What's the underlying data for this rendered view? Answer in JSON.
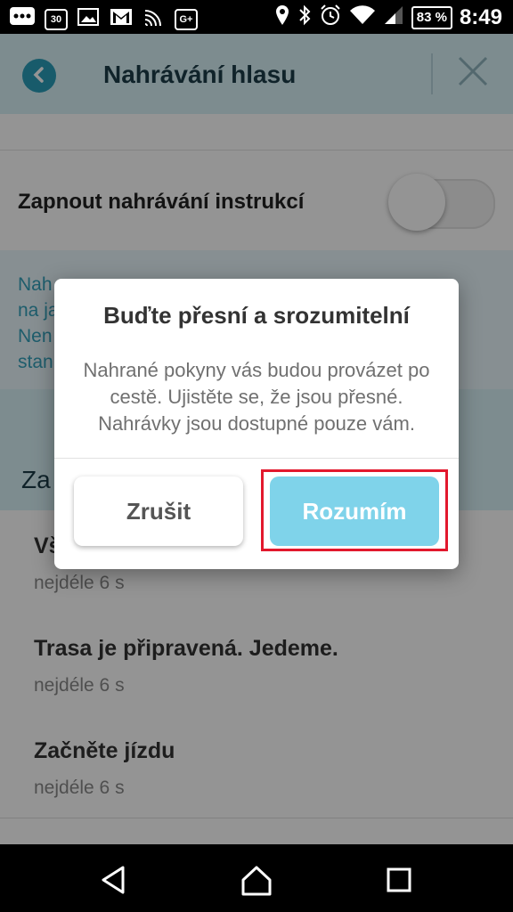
{
  "status_bar": {
    "left_icons": [
      "more-dots-icon",
      "calendar-icon",
      "image-icon",
      "gmail-icon",
      "cast-icon",
      "google-plus-icon"
    ],
    "calendar_day": "30",
    "gplus_text": "G+",
    "battery": "83 %",
    "time": "8:49"
  },
  "header": {
    "title": "Nahrávání hlasu"
  },
  "toggle": {
    "label": "Zapnout nahrávání instrukcí",
    "enabled": false
  },
  "info": {
    "visible_fragments": [
      "Nah",
      "na ja",
      "Nen",
      "stan"
    ]
  },
  "section": {
    "title_fragment": "Za"
  },
  "list": [
    {
      "title": "Vš",
      "subtitle": "nejdéle 6 s"
    },
    {
      "title": "Trasa je připravená. Jedeme.",
      "subtitle": "nejdéle 6 s"
    },
    {
      "title": "Začněte jízdu",
      "subtitle": "nejdéle 6 s"
    }
  ],
  "dialog": {
    "title": "Buďte přesní a srozumitelní",
    "body": "Nahrané pokyny vás budou provázet po cestě. Ujistěte se, že jsou přesné. Nahrávky jsou dostupné pouze vám.",
    "cancel_label": "Zrušit",
    "confirm_label": "Rozumím"
  },
  "colors": {
    "accent": "#2a9db8",
    "confirm_button": "#7fd3ea",
    "highlight": "#e2182d"
  }
}
